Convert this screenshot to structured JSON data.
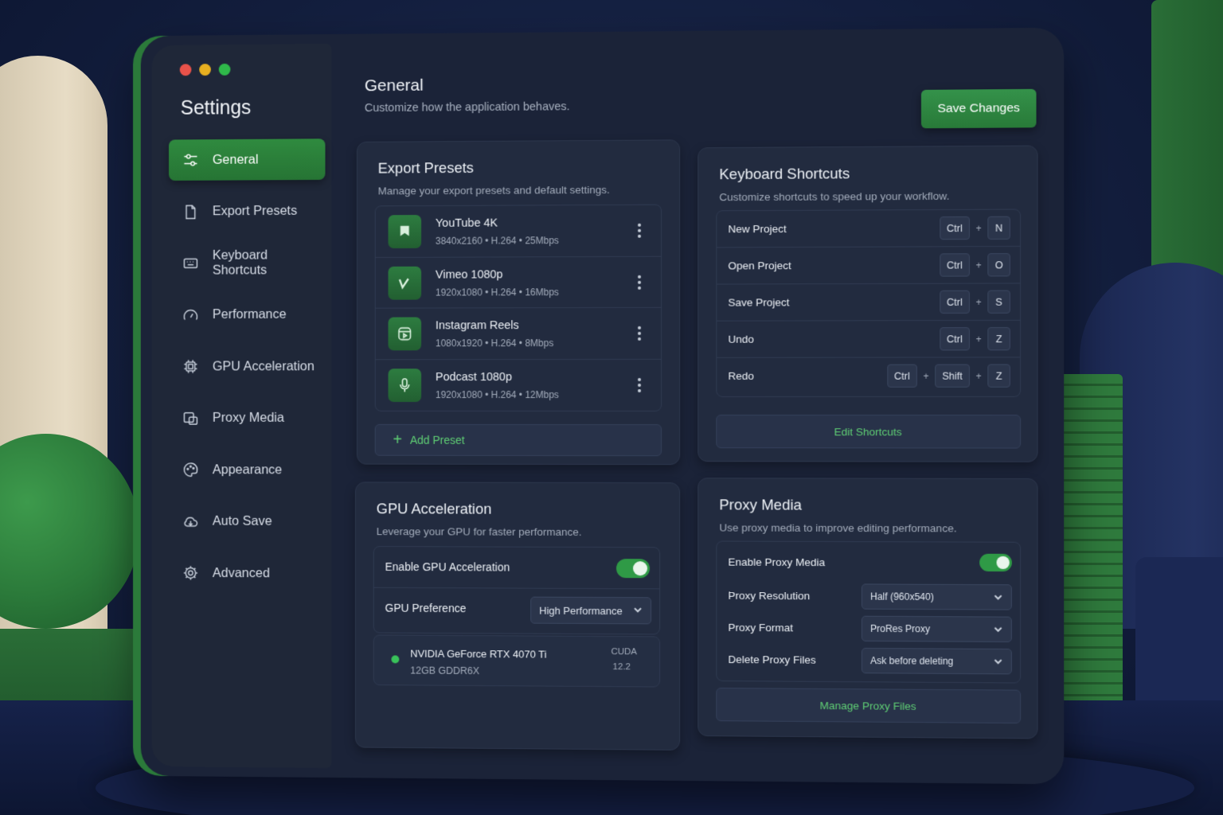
{
  "app": {
    "title": "Settings"
  },
  "sidebar": {
    "items": [
      {
        "label": "General",
        "icon": "sliders-icon",
        "active": true
      },
      {
        "label": "Export Presets",
        "icon": "file-icon"
      },
      {
        "label": "Keyboard Shortcuts",
        "icon": "keyboard-icon"
      },
      {
        "label": "Performance",
        "icon": "speedometer-icon"
      },
      {
        "label": "GPU Acceleration",
        "icon": "chip-icon"
      },
      {
        "label": "Proxy Media",
        "icon": "proxy-icon"
      },
      {
        "label": "Appearance",
        "icon": "palette-icon"
      },
      {
        "label": "Auto Save",
        "icon": "cloud-icon"
      },
      {
        "label": "Advanced",
        "icon": "gear-icon"
      }
    ]
  },
  "header": {
    "title": "General",
    "subtitle": "Customize how the application behaves.",
    "save_label": "Save Changes"
  },
  "export_presets": {
    "title": "Export Presets",
    "subtitle": "Manage your export presets and default settings.",
    "items": [
      {
        "name": "YouTube 4K",
        "meta": "3840x2160 • H.264 • 25Mbps",
        "icon": "flag-icon"
      },
      {
        "name": "Vimeo 1080p",
        "meta": "1920x1080 • H.264 • 16Mbps",
        "icon": "vimeo-icon"
      },
      {
        "name": "Instagram Reels",
        "meta": "1080x1920 • H.264 • 8Mbps",
        "icon": "reels-icon"
      },
      {
        "name": "Podcast 1080p",
        "meta": "1920x1080 • H.264 • 12Mbps",
        "icon": "microphone-icon"
      }
    ],
    "add_label": "Add Preset"
  },
  "keyboard_shortcuts": {
    "title": "Keyboard Shortcuts",
    "subtitle": "Customize shortcuts to speed up your workflow.",
    "items": [
      {
        "action": "New Project",
        "keys": [
          "Ctrl",
          "N"
        ]
      },
      {
        "action": "Open Project",
        "keys": [
          "Ctrl",
          "O"
        ]
      },
      {
        "action": "Save Project",
        "keys": [
          "Ctrl",
          "S"
        ]
      },
      {
        "action": "Undo",
        "keys": [
          "Ctrl",
          "Z"
        ]
      },
      {
        "action": "Redo",
        "keys": [
          "Ctrl",
          "Shift",
          "Z"
        ]
      }
    ],
    "edit_label": "Edit Shortcuts"
  },
  "gpu": {
    "title": "GPU Acceleration",
    "subtitle": "Leverage your GPU for faster performance.",
    "enable_label": "Enable GPU Acceleration",
    "enabled": true,
    "preference_label": "GPU Preference",
    "preference_value": "High Performance",
    "device_name": "NVIDIA GeForce RTX 4070 Ti",
    "device_memory": "12GB GDDR6X",
    "cuda_label": "CUDA",
    "cuda_version": "12.2"
  },
  "proxy": {
    "title": "Proxy Media",
    "subtitle": "Use proxy media to improve editing performance.",
    "enable_label": "Enable Proxy Media",
    "enabled": true,
    "resolution_label": "Proxy Resolution",
    "resolution_value": "Half (960x540)",
    "format_label": "Proxy Format",
    "format_value": "ProRes Proxy",
    "delete_label": "Delete Proxy Files",
    "delete_value": "Ask before deleting",
    "manage_label": "Manage Proxy Files"
  },
  "colors": {
    "accent": "#2f8a3f",
    "accent_text": "#5fcf74",
    "window_bg": "#1b2338",
    "card_bg": "#222b3f"
  }
}
